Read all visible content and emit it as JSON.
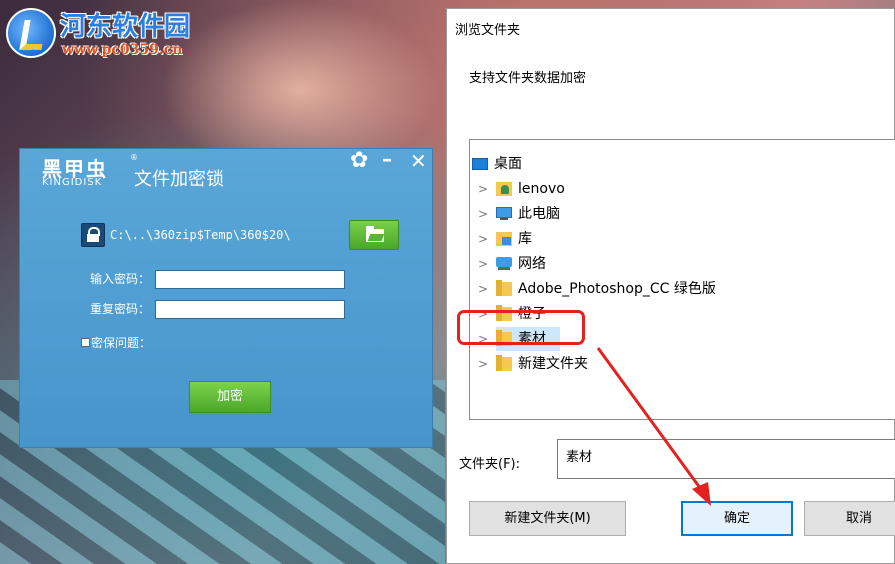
{
  "watermark": {
    "title": "河东软件园",
    "url": "www.pc0359.cn"
  },
  "app": {
    "brand_main": "黑甲虫",
    "brand_reg": "®",
    "brand_sub": "KINGIDISK",
    "title": "文件加密锁",
    "controls": {
      "settings": "✿",
      "minimize": "–",
      "close": "✕"
    },
    "path": "C:\\..\\360zip$Temp\\360$20\\",
    "password_label": "输入密码：",
    "password_value": "",
    "confirm_label": "重复密码：",
    "confirm_value": "",
    "security_question_label": "密保问题：",
    "encrypt_button": "加密",
    "accent_color": "#4a9bd0",
    "button_color": "#5ab634"
  },
  "dialog": {
    "title": "浏览文件夹",
    "description": "支持文件夹数据加密",
    "tree": [
      {
        "label": "桌面",
        "icon": "desktop-icon",
        "expandable": false
      },
      {
        "label": "lenovo",
        "icon": "user-folder-icon",
        "expandable": true
      },
      {
        "label": "此电脑",
        "icon": "computer-icon",
        "expandable": true
      },
      {
        "label": "库",
        "icon": "library-icon",
        "expandable": true
      },
      {
        "label": "网络",
        "icon": "network-icon",
        "expandable": true
      },
      {
        "label": "Adobe_Photoshop_CC  绿色版",
        "icon": "folder-icon",
        "expandable": true
      },
      {
        "label": "橙子",
        "icon": "folder-icon",
        "expandable": true
      },
      {
        "label": "素材",
        "icon": "folder-icon",
        "expandable": true,
        "selected": true
      },
      {
        "label": "新建文件夹",
        "icon": "folder-icon",
        "expandable": true
      }
    ],
    "folder_label": "文件夹(F):",
    "folder_value": "素材",
    "new_folder_button": "新建文件夹(M)",
    "ok_button": "确定",
    "cancel_button": "取消",
    "highlight_color": "#e52020",
    "selection_color": "#cce8ff"
  }
}
